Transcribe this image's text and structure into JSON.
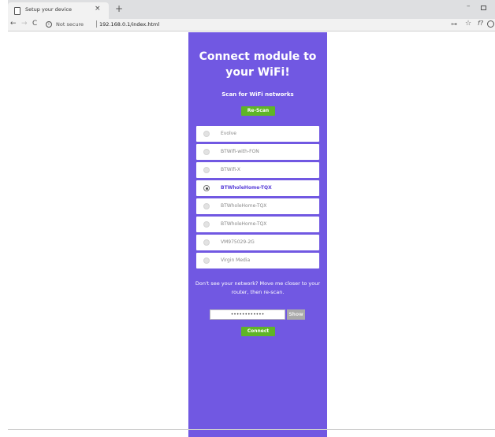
{
  "browser": {
    "tab_title": "Setup your device",
    "tab_close": "×",
    "new_tab": "+",
    "minimize": "–",
    "back": "←",
    "forward": "→",
    "reload": "C",
    "info": "i",
    "not_secure": "Not secure",
    "url": "192.168.0.1/index.html",
    "key_glyph": "⊶",
    "star_glyph": "☆",
    "ext_glyph": "f?"
  },
  "page": {
    "title": "Connect module to your WiFi!",
    "scan_label": "Scan for WiFi networks",
    "rescan_label": "Re-Scan",
    "networks": [
      {
        "name": "Evolve",
        "selected": false
      },
      {
        "name": "BTWifi-with-FON",
        "selected": false
      },
      {
        "name": "BTWifi-X",
        "selected": false
      },
      {
        "name": "BTWholeHome-TQX",
        "selected": true
      },
      {
        "name": "BTWholeHome-TQX",
        "selected": false
      },
      {
        "name": "BTWholeHome-TQX",
        "selected": false
      },
      {
        "name": "VM975029-2G",
        "selected": false
      },
      {
        "name": "Virgin Media",
        "selected": false
      }
    ],
    "hint": "Don't see your network? Move me closer to your router, then re-scan.",
    "password_value": "••••••••••••",
    "show_label": "Show",
    "connect_label": "Connect"
  },
  "colors": {
    "card_bg": "#7158e2",
    "button_green": "#5fb526",
    "selected_text": "#5a40d8"
  }
}
